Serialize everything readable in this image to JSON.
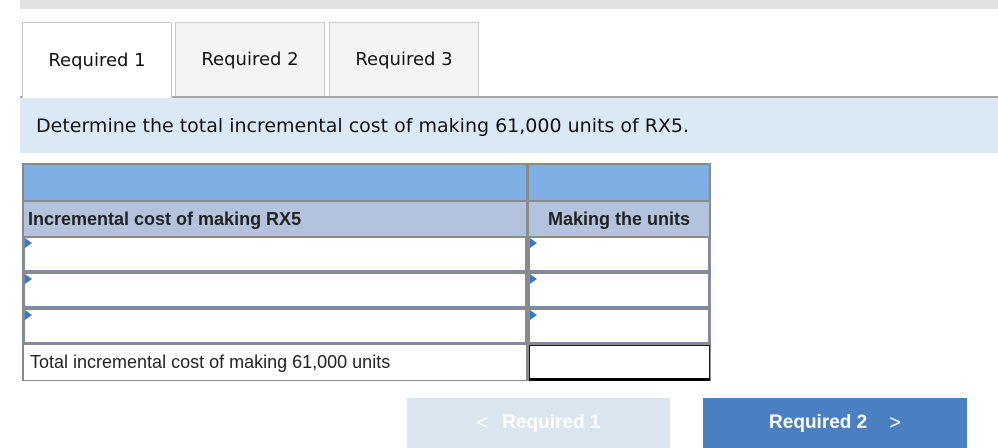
{
  "tabs": [
    {
      "label": "Required 1"
    },
    {
      "label": "Required 2"
    },
    {
      "label": "Required 3"
    }
  ],
  "prompt": "Determine the total incremental cost of making 61,000 units of RX5.",
  "table": {
    "col_header": "Incremental cost of making RX5",
    "value_header": "Making the units",
    "input_rows": [
      {
        "label": "",
        "value": ""
      },
      {
        "label": "",
        "value": ""
      },
      {
        "label": "",
        "value": ""
      }
    ],
    "total_label": "Total incremental cost of making 61,000 units",
    "total_value": ""
  },
  "nav": {
    "prev_chevron": "<",
    "prev_label": "Required 1",
    "next_label": "Required 2",
    "next_chevron": ">"
  },
  "colors": {
    "header_blue": "#7eaee3",
    "subheader": "#b3c3dd",
    "prompt_bg": "#dbe9f7",
    "next_button": "#4a7fc1",
    "prev_button_disabled": "#dbe5f0"
  }
}
